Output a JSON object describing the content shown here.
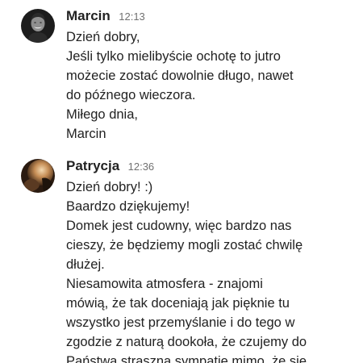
{
  "messages": [
    {
      "author": "Marcin",
      "time": "12:13",
      "avatar_icon": "person-avatar-photo",
      "lines": [
        "Dzień dobry,",
        "Jeśli tylko mielibyście ochotę to jutro",
        "możecie zostać dowolnie długo, nawet",
        "do późnego wieczora.",
        "Miłego dnia,",
        "Marcin"
      ]
    },
    {
      "author": "Patrycja",
      "time": "12:36",
      "avatar_icon": "person-avatar-photo",
      "lines": [
        "Dzień dobry! :)",
        "Baardzo dziękujemy!",
        "Domek jest cudowny, więc bardzo nas",
        "cieszy, że będziemy mogli zostać chwilę",
        "dłużej.",
        "Niesamowita atmosfera - znajomi",
        "mówią, że tak doceniają jak pięknie tu",
        "wszystko jest przemyślanie i do tego w",
        "zgodzie z naturą dookoła, że czujemy do",
        "Państwa straszną sympatię mimo, że się"
      ]
    }
  ]
}
